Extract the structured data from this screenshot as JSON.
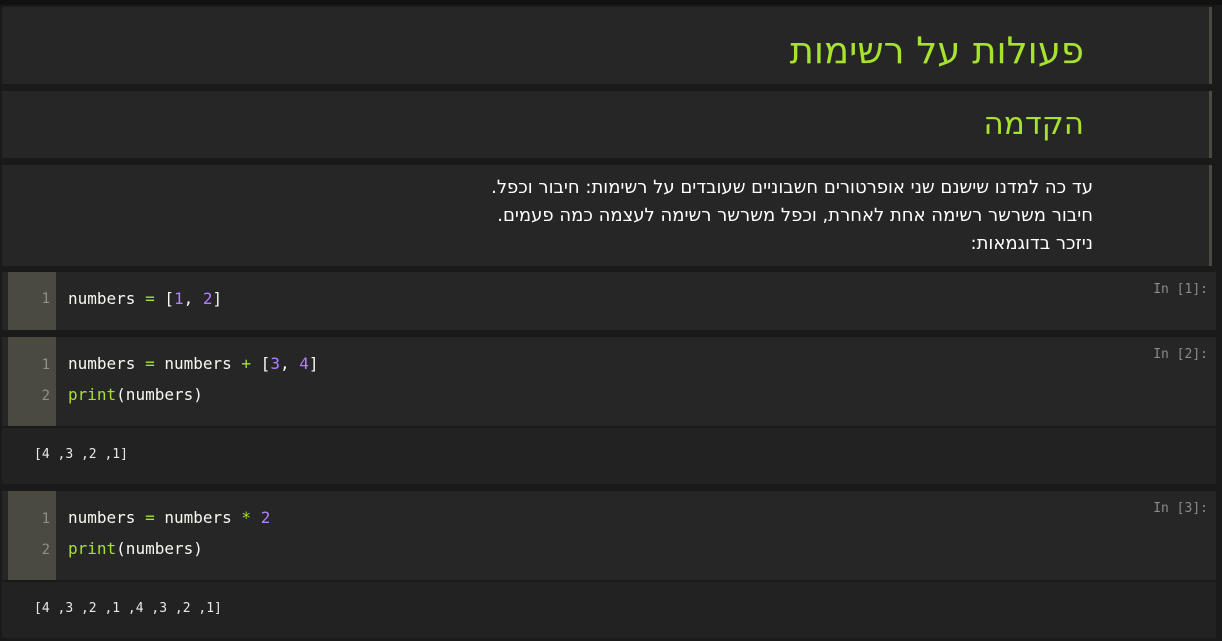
{
  "notebook": {
    "title": "פעולות על רשימות",
    "section": "הקדמה",
    "intro_lines": [
      "עד כה למדנו שישנם שני אופרטורים חשבוניים שעובדים על רשימות: חיבור וכפל.",
      "חיבור משרשר רשימה אחת לאחרת, וכפל משרשר רשימה לעצמה כמה פעמים.",
      "ניזכר בדוגמאות:"
    ],
    "cells": [
      {
        "prompt": "In [1]:",
        "line_numbers": [
          "1"
        ],
        "code_lines": [
          "numbers = [1, 2]"
        ]
      },
      {
        "prompt": "In [2]:",
        "line_numbers": [
          "1",
          "2"
        ],
        "code_lines": [
          "numbers = numbers + [3, 4]",
          "print(numbers)"
        ],
        "output": "[1, 2, 3, 4]"
      },
      {
        "prompt": "In [3]:",
        "line_numbers": [
          "1",
          "2"
        ],
        "code_lines": [
          "numbers = numbers * 2",
          "print(numbers)"
        ],
        "output": "[1, 2, 3, 4, 1, 2, 3, 4]"
      }
    ]
  },
  "colors": {
    "heading": "#a6e22e",
    "operator": "#a6e22e",
    "number": "#ae81ff",
    "builtin": "#a6e22e",
    "cell_bg": "#262626",
    "gutter_bg": "#4a4a40"
  }
}
